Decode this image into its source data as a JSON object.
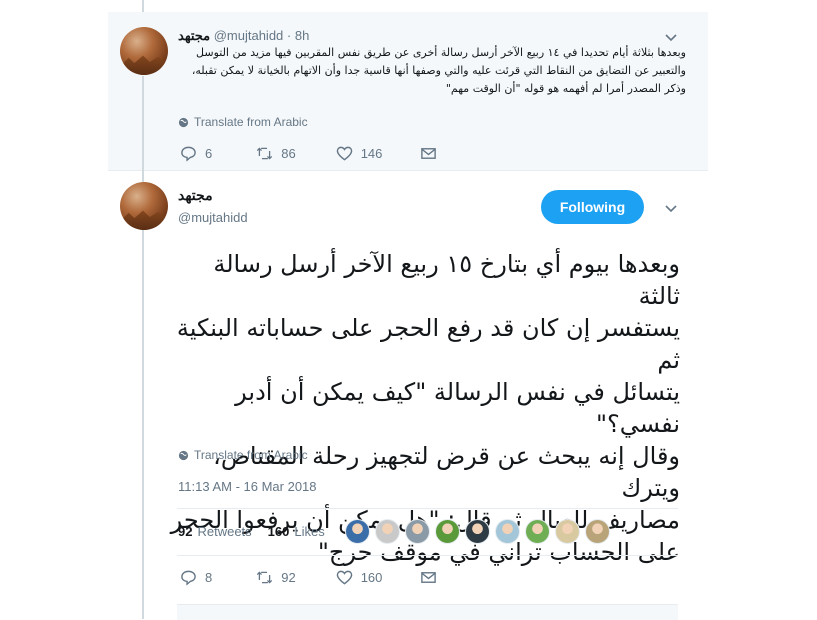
{
  "parent_tweet": {
    "name": "مجتهد",
    "handle": "@mujtahidd",
    "time": "· 8h",
    "text_lines": [
      "وبعدها بثلاثة أيام تحديدا في ١٤ ربيع الآخر أرسل رسالة أخرى عن طريق نفس المقربين فيها مزيد من التوسل",
      "والتعبير عن التضايق من النقاط التي قرئت عليه والتي وصفها أنها قاسية جدا وأن الاتهام بالخيانة لا يمكن تقبله،",
      "وذكر المصدر أمرا لم أفهمه هو قوله \"أن الوقت مهم\""
    ],
    "translate_label": "Translate from Arabic",
    "replies": "6",
    "retweets": "86",
    "likes": "146"
  },
  "main_tweet": {
    "name": "مجتهد",
    "handle": "@mujtahidd",
    "follow_label": "Following",
    "text_lines": [
      "وبعدها بيوم أي بتارخ ١٥ ربيع الآخر أرسل رسالة ثالثة",
      "يستفسر إن كان قد رفع الحجر على حساباته البنكية ثم",
      "يتسائل في نفس الرسالة \"كيف يمكن أن أدبر نفسي؟\"",
      "وقال إنه يبحث عن قرض لتجهيز رحلة المقناص، ويترك",
      "مصاريف للعيال ثم قال: \"هل يمكن أن يرفعوا الحجر",
      "على الحساب تراني في موقف حرج\""
    ],
    "translate_label": "Translate from Arabic",
    "timestamp": "11:13 AM - 16 Mar 2018",
    "retweet_count": "92",
    "retweet_label": "Retweets",
    "like_count": "160",
    "like_label": "Likes",
    "replies": "8",
    "retweets": "92",
    "likes": "160"
  },
  "likers": [
    {
      "color": "#3b6ea8"
    },
    {
      "color": "#c9c9c9"
    },
    {
      "color": "#8a9aa6"
    },
    {
      "color": "#5a9a3a"
    },
    {
      "color": "#2f3b44"
    },
    {
      "color": "#a3c6d8"
    },
    {
      "color": "#6fae54"
    },
    {
      "color": "#d9c9a0"
    },
    {
      "color": "#b9a47a"
    }
  ],
  "colors": {
    "accent": "#1da1f2",
    "muted": "#657786",
    "thread_line": "#cfd9de"
  }
}
